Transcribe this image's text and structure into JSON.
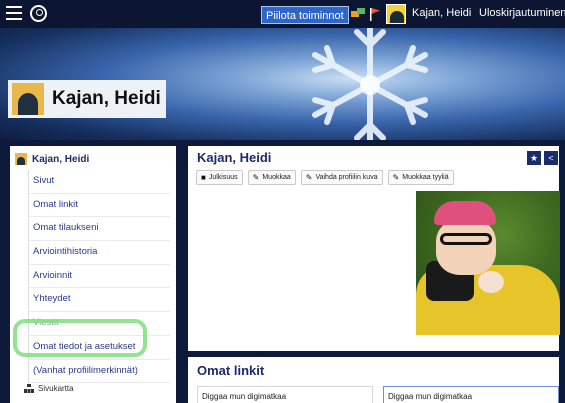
{
  "topbar": {
    "hide_tools": "Piilota toiminnot",
    "user_name": "Kajan, Heidi",
    "logout": "Uloskirjautuminen"
  },
  "banner": {
    "profile_name": "Kajan, Heidi"
  },
  "sidebar": {
    "profile_name": "Kajan, Heidi",
    "items": [
      {
        "label": "Sivut"
      },
      {
        "label": "Omat linkit"
      },
      {
        "label": "Omat tilaukseni"
      },
      {
        "label": "Arviointihistoria"
      },
      {
        "label": "Arvioinnit"
      },
      {
        "label": "Yhteydet"
      },
      {
        "label": "Viestit"
      },
      {
        "label": "Omat tiedot ja asetukset"
      },
      {
        "label": "(Vanhat profiilimerkinnät)"
      }
    ],
    "sitemap": "Sivukartta"
  },
  "profile": {
    "title": "Kajan, Heidi",
    "actions": {
      "publicity": "Julkisuus",
      "edit": "Muokkaa",
      "change_picture": "Vaihda profiilin kuva",
      "edit_style": "Muokkaa tyyliä"
    }
  },
  "links": {
    "title": "Omat linkit",
    "items": [
      {
        "label": "Diggaa mun digimatkaa"
      },
      {
        "label": "Diggaa mun digimatkaa"
      }
    ]
  },
  "colors": {
    "nav_bg": "#0c1633",
    "accent_blue": "#2f64c8",
    "title_navy": "#1b2a6b",
    "highlight_green": "#7ee07a"
  }
}
